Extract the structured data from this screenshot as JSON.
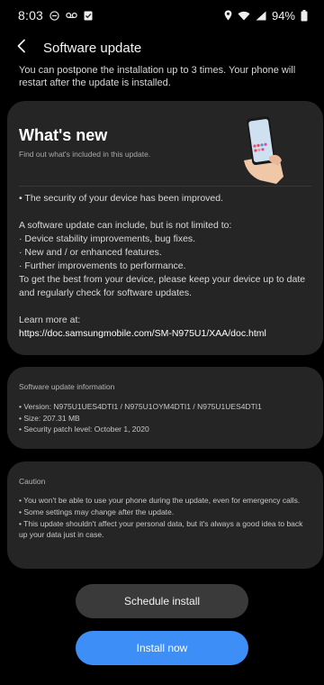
{
  "status_bar": {
    "time": "8:03",
    "battery": "94%",
    "icons": [
      "minus-circle-icon",
      "voicemail-icon",
      "card-icon",
      "location-icon",
      "wifi-icon",
      "signal-icon",
      "battery-icon"
    ]
  },
  "header": {
    "title": "Software update",
    "back_icon": "back-arrow-icon"
  },
  "intro": {
    "text": "You can postpone the installation up to 3 times. Your phone will restart after the update is installed."
  },
  "whats_new": {
    "title": "What's new",
    "subtitle": "Find out what's included in this update.",
    "illustration": "phone-in-hand-illustration",
    "lines": [
      "• The security of your device has been improved.",
      "",
      "A software update can include, but is not limited to:",
      " · Device stability improvements, bug fixes.",
      " · New and / or enhanced features.",
      " · Further improvements to performance.",
      "To get the best from your device, please keep your device up to date and regularly check for software updates.",
      "",
      "Learn more at:"
    ],
    "link": "https://doc.samsungmobile.com/SM-N975U1/XAA/doc.html"
  },
  "software_info": {
    "title": "Software update information",
    "lines": [
      "• Version: N975U1UES4DTI1 / N975U1OYM4DTI1 / N975U1UES4DTI1",
      "• Size: 207.31 MB",
      "• Security patch level: October 1, 2020"
    ]
  },
  "caution": {
    "title": "Caution",
    "lines": [
      "• You won't be able to use your phone during the update, even for emergency calls.",
      "• Some settings may change after the update.",
      "• This update shouldn't affect your personal data, but it's always a good idea to back up your data just in case."
    ]
  },
  "buttons": {
    "schedule": "Schedule install",
    "install": "Install now"
  },
  "colors": {
    "background": "#000000",
    "card": "#252525",
    "primary": "#3e8ef7",
    "secondary_button": "#3a3a3a"
  }
}
